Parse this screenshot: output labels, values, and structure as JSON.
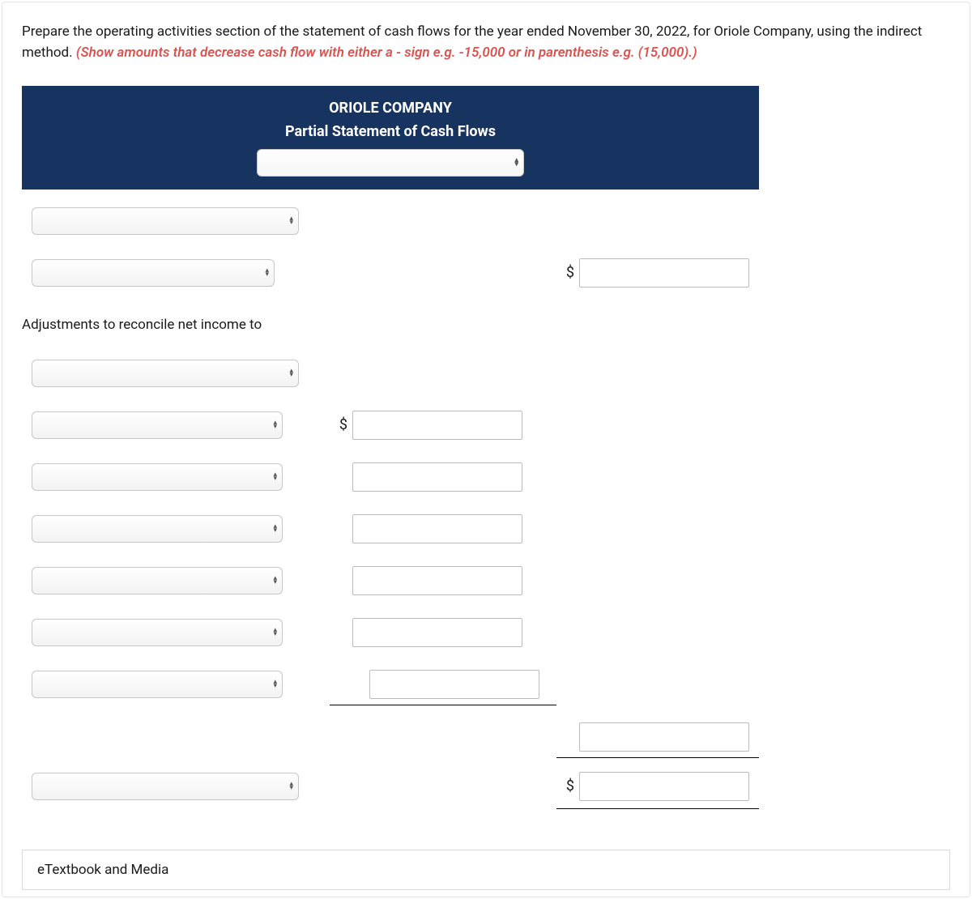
{
  "instructions": {
    "main": "Prepare the operating activities section of the statement of cash flows for the year ended November 30, 2022, for Oriole Company, using the indirect method. ",
    "hint": "(Show amounts that decrease cash flow with either a - sign e.g. -15,000 or in parenthesis e.g. (15,000).)"
  },
  "header": {
    "company": "ORIOLE COMPANY",
    "title": "Partial Statement of Cash Flows",
    "period_select_value": ""
  },
  "rows": {
    "r1_select": "",
    "r2_select": "",
    "r2_amount_c": "",
    "label_adjust": "Adjustments to reconcile net income to",
    "r3_select": "",
    "r4_select": "",
    "r4_amount_b": "",
    "r5_select": "",
    "r5_amount_b": "",
    "r6_select": "",
    "r6_amount_b": "",
    "r7_select": "",
    "r7_amount_b": "",
    "r8_select": "",
    "r8_amount_b": "",
    "r9_select": "",
    "r9_amount_b": "",
    "subtotal_c": "",
    "r10_select": "",
    "r10_amount_c": ""
  },
  "currency": "$",
  "etextbook_label": "eTextbook and Media"
}
